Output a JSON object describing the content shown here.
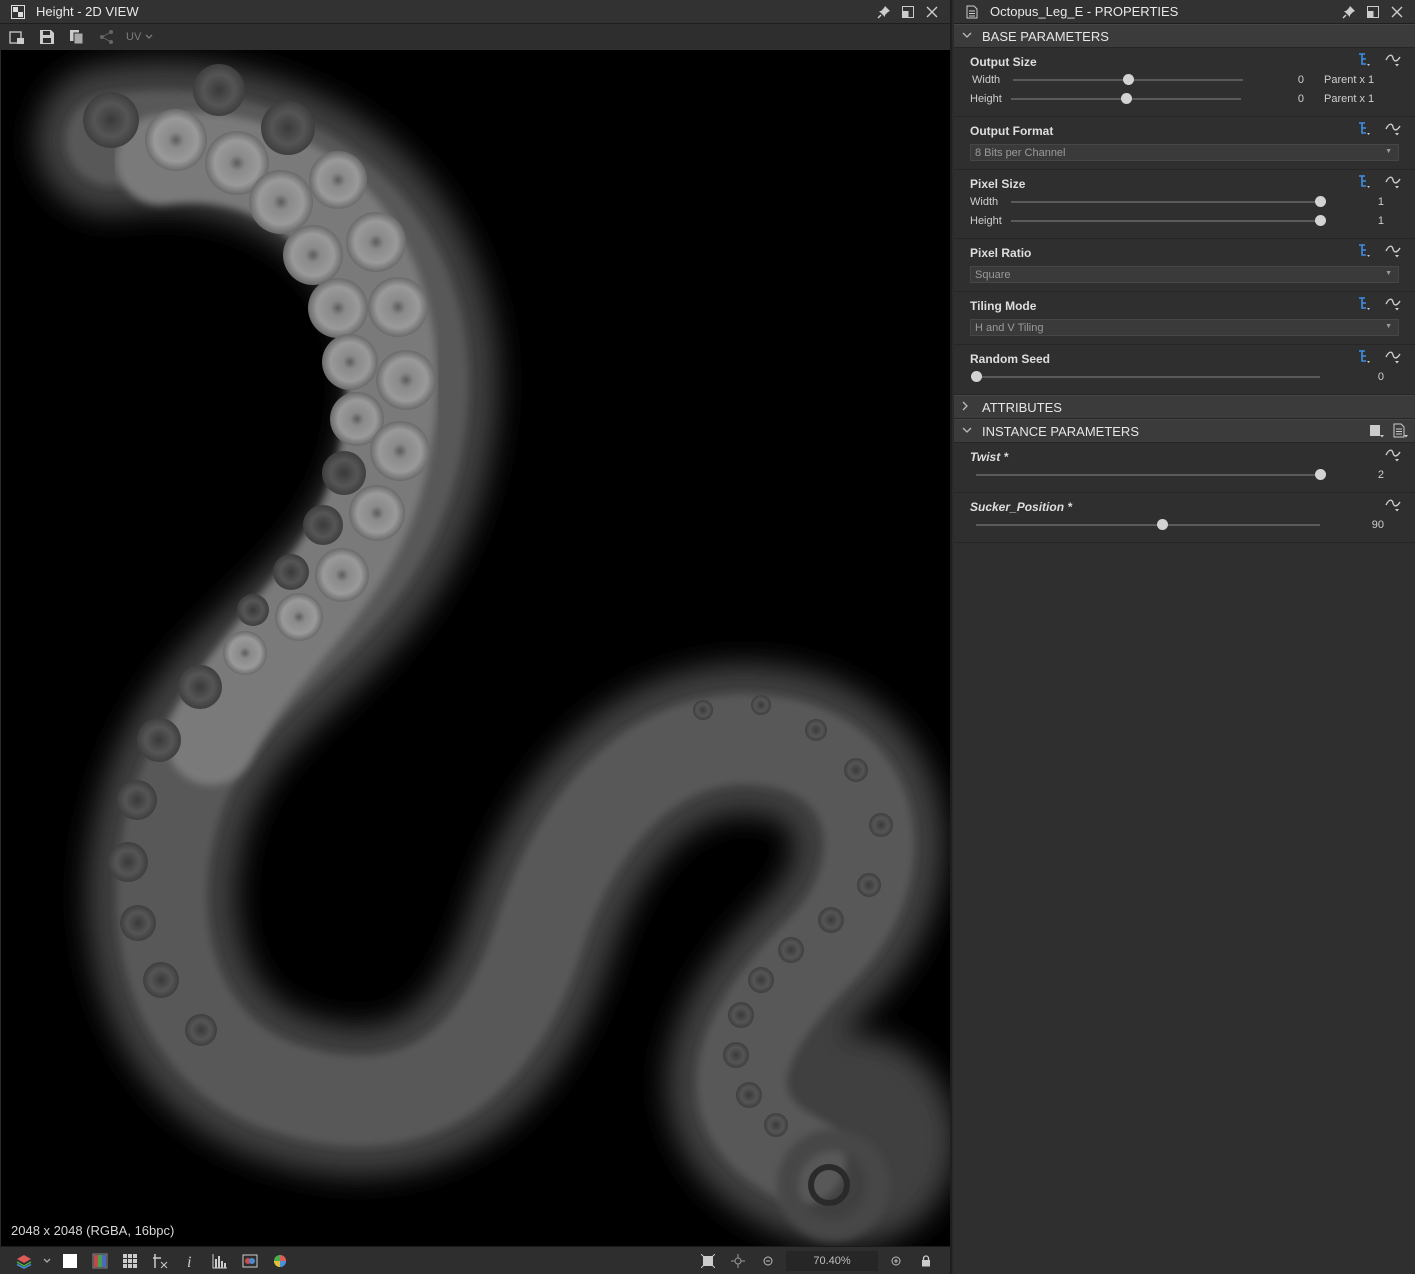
{
  "view2d": {
    "title": "Height - 2D VIEW",
    "toolbar": {
      "uv_label": "UV"
    },
    "image_info": "2048 x 2048 (RGBA, 16bpc)",
    "zoom": "70.40%"
  },
  "properties": {
    "title": "Octopus_Leg_E - PROPERTIES",
    "sections": {
      "base": "BASE PARAMETERS",
      "attributes": "ATTRIBUTES",
      "instance": "INSTANCE PARAMETERS"
    },
    "output_size": {
      "label": "Output Size",
      "width_label": "Width",
      "width_value": "0",
      "width_extra": "Parent x 1",
      "width_fraction": 0.5,
      "height_label": "Height",
      "height_value": "0",
      "height_extra": "Parent x 1",
      "height_fraction": 0.5
    },
    "output_format": {
      "label": "Output Format",
      "value": "8 Bits per Channel"
    },
    "pixel_size": {
      "label": "Pixel Size",
      "width_label": "Width",
      "width_value": "1",
      "width_fraction": 1.0,
      "height_label": "Height",
      "height_value": "1",
      "height_fraction": 1.0
    },
    "pixel_ratio": {
      "label": "Pixel Ratio",
      "value": "Square"
    },
    "tiling_mode": {
      "label": "Tiling Mode",
      "value": "H and V Tiling"
    },
    "random_seed": {
      "label": "Random Seed",
      "value": "0",
      "fraction": 0.0
    },
    "twist": {
      "label": "Twist *",
      "value": "2",
      "fraction": 1.0
    },
    "sucker_position": {
      "label": "Sucker_Position *",
      "value": "90",
      "fraction": 0.54
    }
  }
}
